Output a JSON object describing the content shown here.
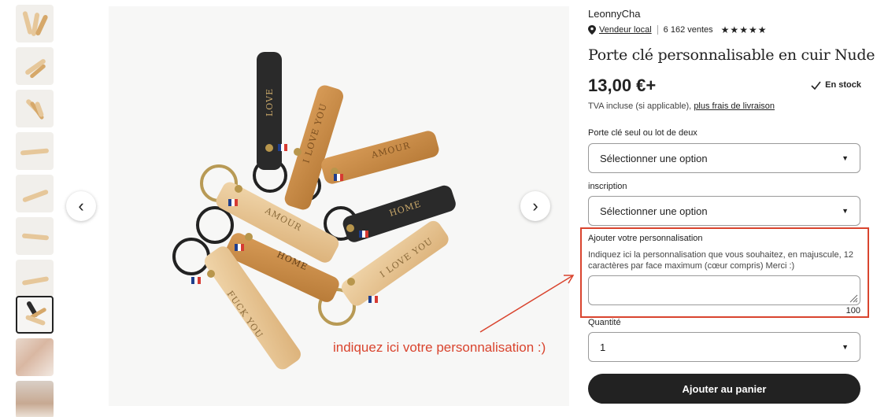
{
  "thumbnails": [
    "thumb-1",
    "thumb-2",
    "thumb-3",
    "thumb-4",
    "thumb-5",
    "thumb-6",
    "thumb-7",
    "thumb-8",
    "thumb-9",
    "thumb-10"
  ],
  "main_image": {
    "keychain_texts": [
      "LOVE",
      "I LOVE YOU",
      "AMOUR",
      "HOME",
      "AMOUR",
      "HOME",
      "I LOVE YOU",
      "FUCK YOU"
    ],
    "nav_prev": "‹",
    "nav_next": "›"
  },
  "annotation": {
    "text": "indiquez ici votre personnalisation :)",
    "color": "#d9442e"
  },
  "shop": {
    "name": "LeonnyCha",
    "seller_type": "Vendeur local",
    "sales": "6 162 ventes",
    "stars": "★★★★★"
  },
  "product": {
    "title": "Porte clé personnalisable en cuir Nude",
    "price": "13,00 €+",
    "stock": "En stock",
    "tax_text": "TVA incluse (si applicable),",
    "shipping_link": "plus frais de livraison"
  },
  "options": {
    "variant_label": "Porte clé seul ou lot de deux",
    "variant_value": "Sélectionner une option",
    "inscription_label": "inscription",
    "inscription_value": "Sélectionner une option"
  },
  "personalization": {
    "label": "Ajouter votre personnalisation",
    "help": "Indiquez ici la personnalisation que vous souhaitez, en majuscule, 12 caractères par face maximum (cœur compris) Merci :)",
    "value": "",
    "char_count": "100"
  },
  "quantity": {
    "label": "Quantité",
    "value": "1"
  },
  "cart_button": "Ajouter au panier",
  "colors": {
    "accent_red": "#d9442e",
    "button_dark": "#222222",
    "leather_nude": "#e8c99b",
    "leather_tan": "#c98f4a",
    "leather_black": "#2a2a2a"
  }
}
